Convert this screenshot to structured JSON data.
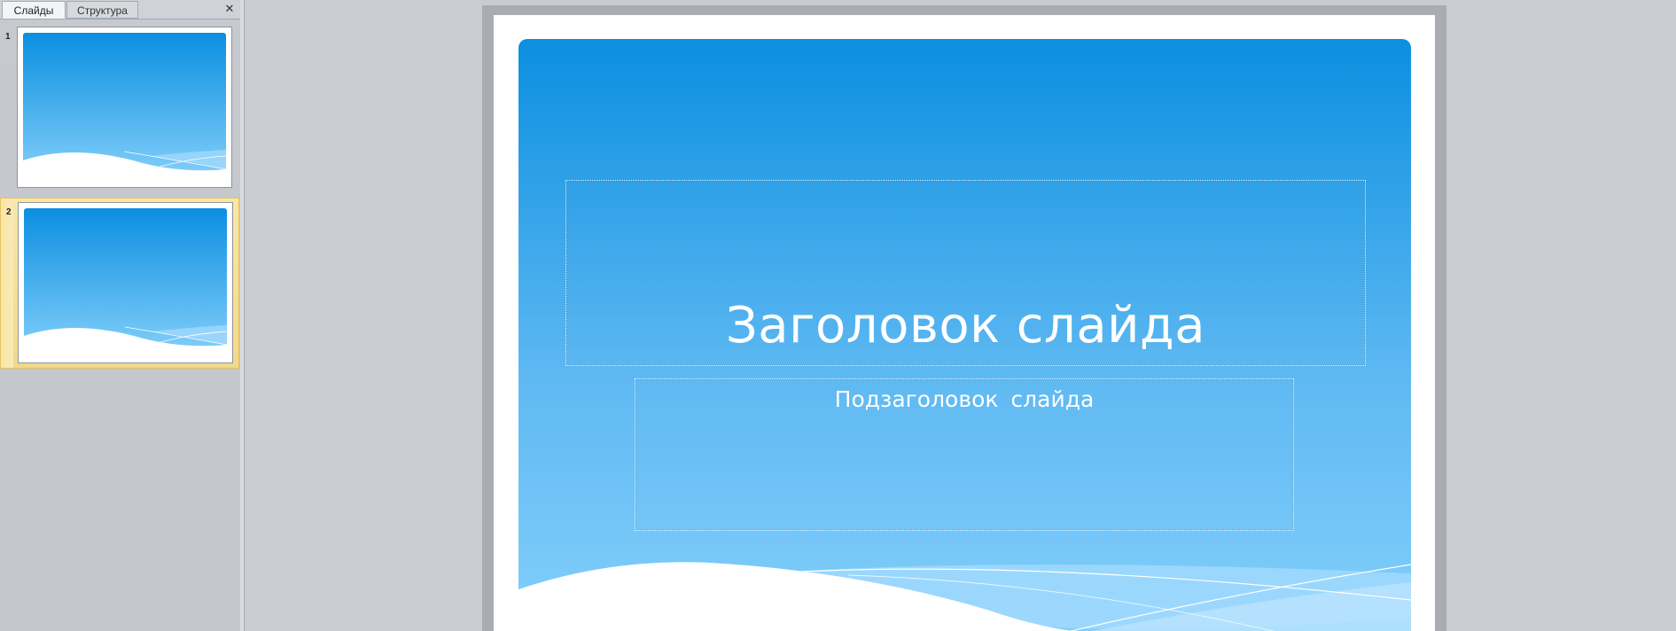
{
  "panel": {
    "tabs": [
      {
        "label": "Слайды",
        "active": true
      },
      {
        "label": "Структура",
        "active": false
      }
    ],
    "close_icon": "close-icon",
    "slides": [
      {
        "number": "1",
        "selected": false
      },
      {
        "number": "2",
        "selected": true
      }
    ]
  },
  "slide": {
    "title": "Заголовок слайда",
    "subtitle": "Подзаголовок  слайда"
  },
  "colors": {
    "sky_top": "#0b8fe0",
    "sky_bottom": "#85d0fb",
    "selection": "#f5dc8f",
    "frame": "#a9adb3"
  }
}
